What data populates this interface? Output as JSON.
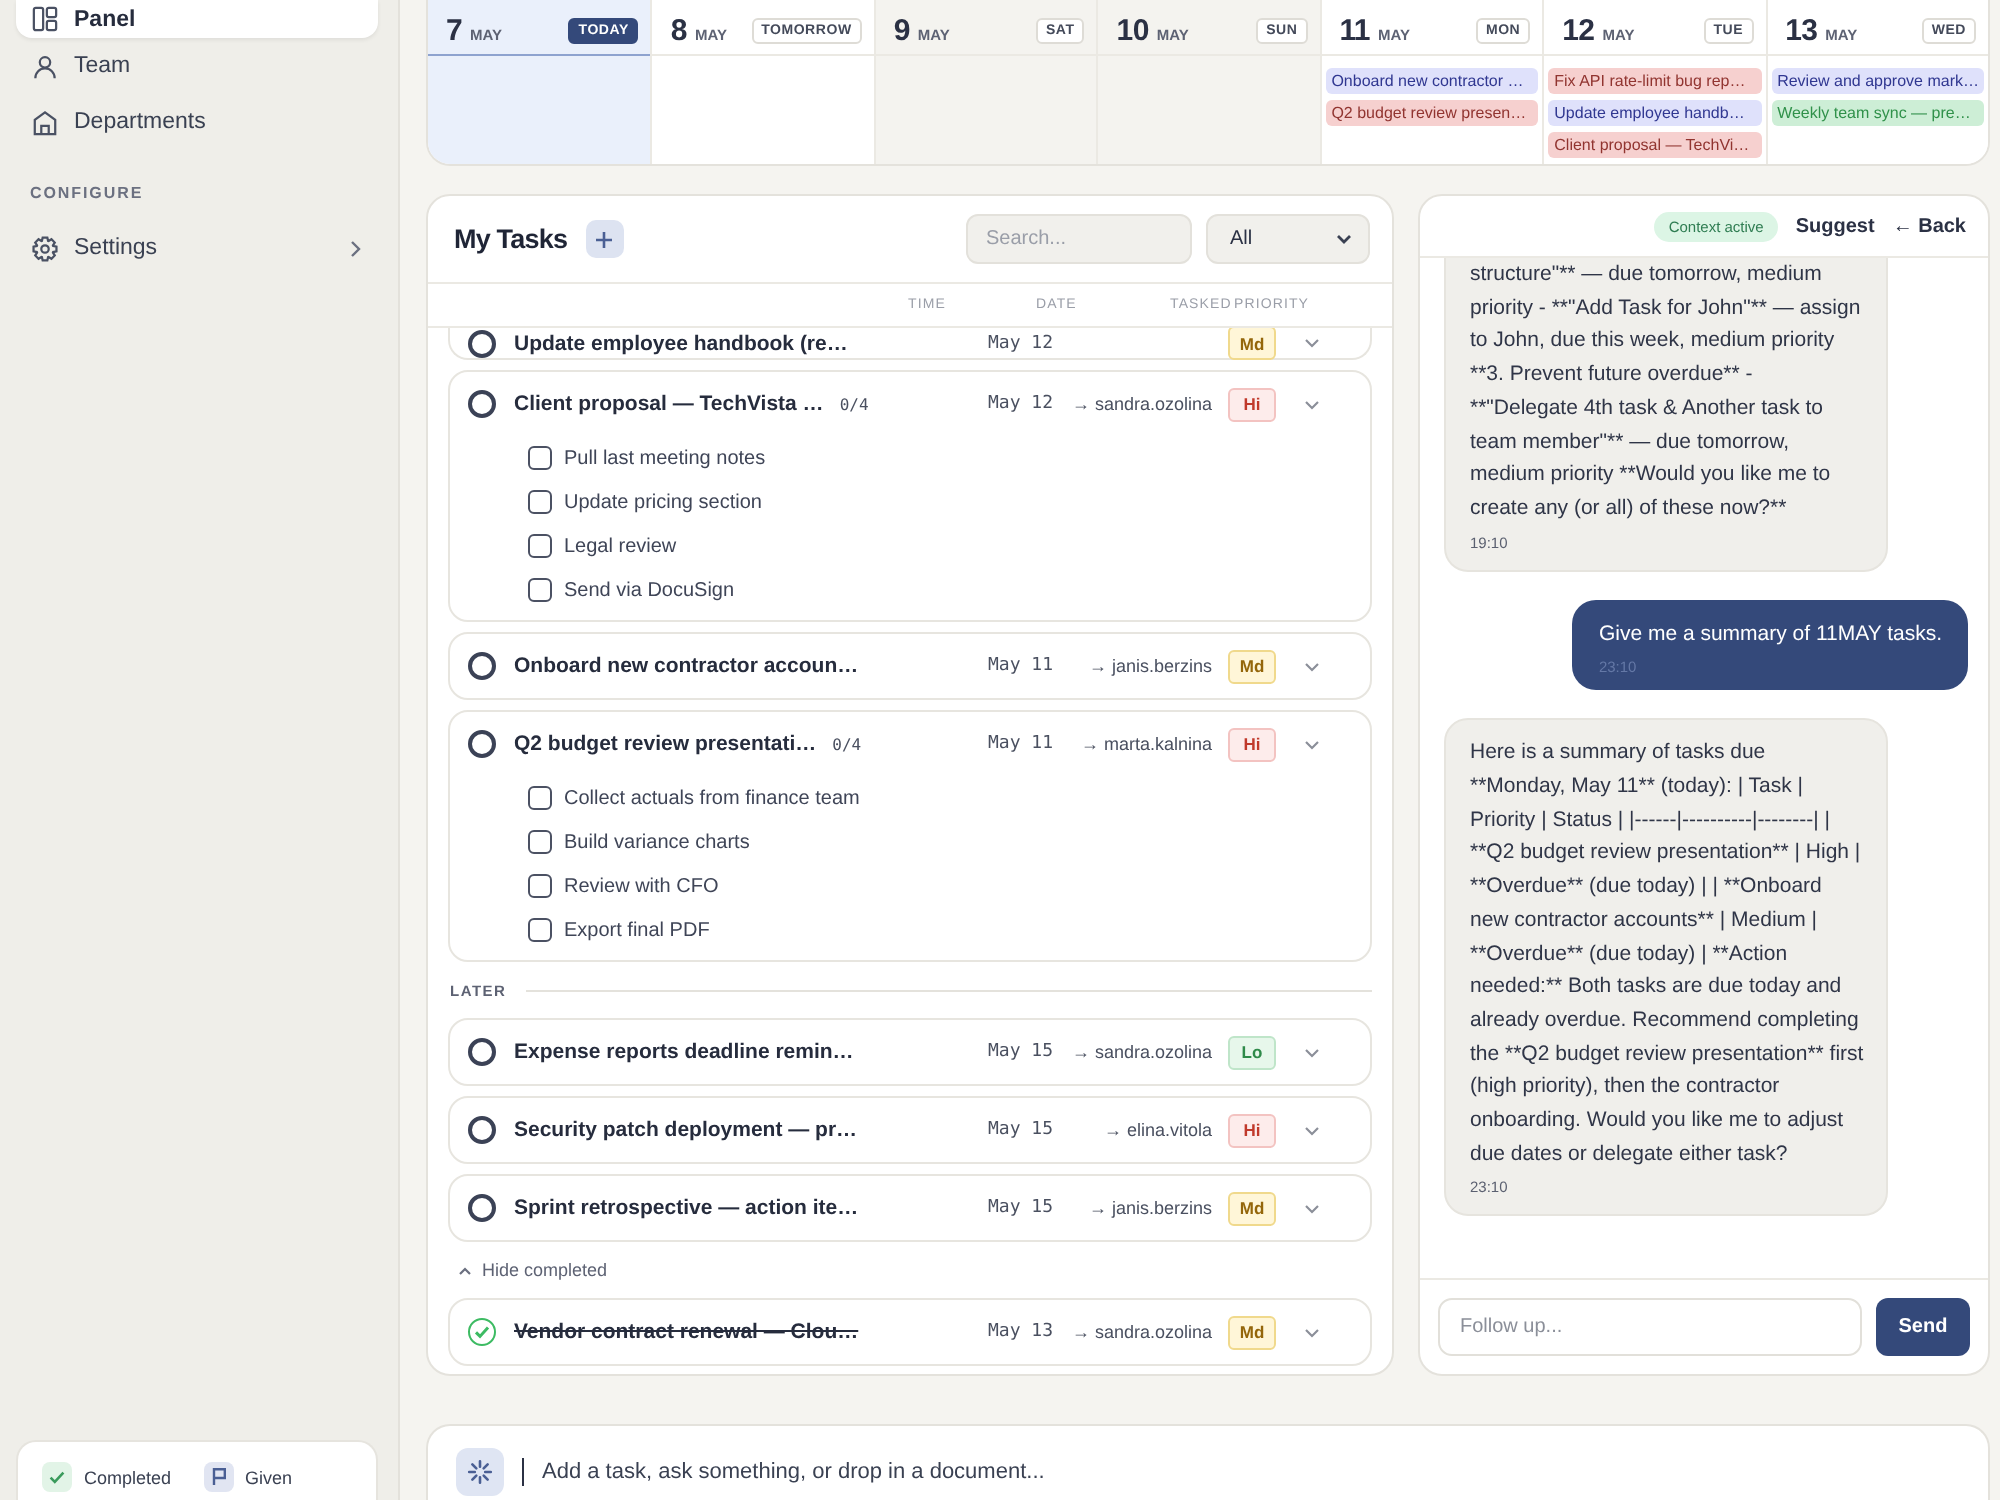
{
  "sidebar": {
    "items": [
      {
        "label": "Panel",
        "kind": "grid",
        "selected": true
      },
      {
        "label": "Team",
        "kind": "person",
        "selected": false
      },
      {
        "label": "Departments",
        "kind": "building",
        "selected": false
      }
    ],
    "sections": [
      {
        "label": "CONFIGURE",
        "items": [
          {
            "label": "Settings",
            "kind": "gear",
            "selected": false,
            "submenu": true
          }
        ]
      }
    ],
    "footer": [
      {
        "label": "Completed",
        "kind": "check"
      },
      {
        "label": "Given",
        "kind": "flag"
      }
    ]
  },
  "calendar": {
    "days": [
      {
        "day": "7",
        "month": "MAY",
        "badge": "TODAY",
        "today": true,
        "weekend": false
      },
      {
        "day": "8",
        "month": "MAY",
        "badge": "TOMORROW",
        "today": false,
        "weekend": false
      },
      {
        "day": "9",
        "month": "MAY",
        "badge": "SAT",
        "today": false,
        "weekend": true
      },
      {
        "day": "10",
        "month": "MAY",
        "badge": "SUN",
        "today": false,
        "weekend": true
      },
      {
        "day": "11",
        "month": "MAY",
        "badge": "MON",
        "today": false,
        "weekend": false,
        "events": [
          {
            "title": "Onboard new contractor …",
            "color": "#dfe1fb"
          },
          {
            "title": "Q2 budget review presen…",
            "color": "#f6d0cf"
          }
        ]
      },
      {
        "day": "12",
        "month": "MAY",
        "badge": "TUE",
        "today": false,
        "weekend": false,
        "events": [
          {
            "title": "Fix API rate-limit bug rep…",
            "color": "#f6d0cf"
          },
          {
            "title": "Update employee handb…",
            "color": "#dfe1fb"
          },
          {
            "title": "Client proposal — TechVi…",
            "color": "#f6d0cf"
          }
        ]
      },
      {
        "day": "13",
        "month": "MAY",
        "badge": "WED",
        "today": false,
        "weekend": false,
        "events": [
          {
            "title": "Review and approve mark…",
            "color": "#dfe1fb"
          },
          {
            "title": "Weekly team sync — pre…",
            "color": "#cdeed6"
          }
        ]
      }
    ]
  },
  "tasks": {
    "title": "My Tasks",
    "search": {
      "placeholder": "Search..."
    },
    "filter": {
      "value": "All"
    },
    "columns": [
      "TIME",
      "DATE",
      "TASKED",
      "PRIORITY"
    ],
    "sections": [
      {
        "tasks": [
          {
            "title": "Update employee handbook (re…",
            "date": "May 12",
            "priority": "Md",
            "kind": "medium",
            "done": false
          },
          {
            "title": "Client proposal — TechVista …",
            "count": "0/4",
            "date": "May 12",
            "assignee": "→ sandra.ozolina",
            "priority": "Hi",
            "kind": "high",
            "done": false,
            "subtasks": [
              {
                "label": "Pull last meeting notes",
                "checked": false
              },
              {
                "label": "Update pricing section",
                "checked": false
              },
              {
                "label": "Legal review",
                "checked": false
              },
              {
                "label": "Send via DocuSign",
                "checked": false
              }
            ]
          },
          {
            "title": "Onboard new contractor accoun…",
            "date": "May 11",
            "assignee": "→ janis.berzins",
            "priority": "Md",
            "kind": "medium",
            "done": false
          },
          {
            "title": "Q2 budget review presentati…",
            "count": "0/4",
            "date": "May 11",
            "assignee": "→ marta.kalnina",
            "priority": "Hi",
            "kind": "high",
            "done": false,
            "subtasks": [
              {
                "label": "Collect actuals from finance team",
                "checked": false
              },
              {
                "label": "Build variance charts",
                "checked": false
              },
              {
                "label": "Review with CFO",
                "checked": false
              },
              {
                "label": "Export final PDF",
                "checked": false
              }
            ]
          }
        ]
      },
      {
        "label": "LATER",
        "tasks": [
          {
            "title": "Expense reports deadline remin…",
            "date": "May 15",
            "assignee": "→ sandra.ozolina",
            "priority": "Lo",
            "kind": "low",
            "done": false
          },
          {
            "title": "Security patch deployment — pr…",
            "date": "May 15",
            "assignee": "→ elina.vitola",
            "priority": "Hi",
            "kind": "high",
            "done": false
          },
          {
            "title": "Sprint retrospective — action ite…",
            "date": "May 15",
            "assignee": "→ janis.berzins",
            "priority": "Md",
            "kind": "medium",
            "done": false
          }
        ]
      }
    ],
    "completed": {
      "toggle": "Hide completed",
      "expanded": true,
      "tasks": [
        {
          "title": "Vendor contract renewal — Clou…",
          "date": "May 13",
          "assignee": "→ sandra.ozolina",
          "priority": "Md",
          "kind": "medium",
          "done": true
        }
      ]
    }
  },
  "chat": {
    "badge": "Context active",
    "actions": [
      "Suggest",
      "← Back"
    ],
    "messages": [
      {
        "kind": "assistant",
        "text": "structure\"** — due tomorrow, medium priority - **\"Add Task for John\"** — assign to John, due this week, medium priority **3. Prevent future overdue** - **\"Delegate 4th task & Another task to team member\"** — due tomorrow, medium priority **Would you like me to create any (or all) of these now?**",
        "time": "19:10"
      },
      {
        "kind": "user",
        "text": "Give me a summary of 11MAY tasks.",
        "time": "23:10"
      },
      {
        "kind": "assistant",
        "text": "Here is a summary of tasks due **Monday, May 11** (today): | Task | Priority | Status | |------|----------|--------| | **Q2 budget review presentation** | High | **Overdue** (due today) | | **Onboard new contractor accounts** | Medium | **Overdue** (due today) | **Action needed:** Both tasks are due today and already overdue. Recommend completing the **Q2 budget review presentation** first (high priority), then the contractor onboarding. Would you like me to adjust due dates or delegate either task?",
        "time": "23:10"
      }
    ],
    "input": {
      "placeholder": "Follow up..."
    },
    "send": "Send"
  },
  "composer": {
    "placeholder": "Add a task, ask something, or drop in a document..."
  }
}
